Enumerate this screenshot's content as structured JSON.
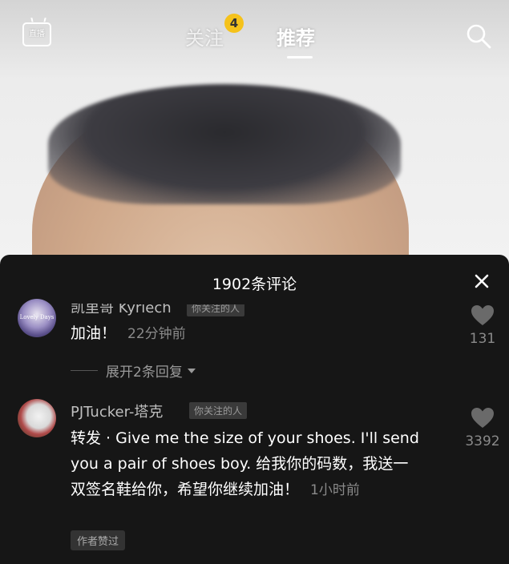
{
  "top_bar": {
    "live_label": "直播",
    "tabs": [
      {
        "label": "关注",
        "badge": "4"
      },
      {
        "label": "推荐",
        "active": true
      }
    ]
  },
  "sheet": {
    "title": "1902条评论",
    "comments": [
      {
        "user": "凯里哥 Kyriech",
        "avatar_text": "Lovely Days",
        "tag": "你关注的人",
        "text": "加油！",
        "time": "22分钟前",
        "likes": "131",
        "expand_label": "展开2条回复"
      },
      {
        "user": "PJTucker-塔克",
        "tag": "你关注的人",
        "text": "转发 · Give me the size of your shoes. I'll send you a pair of shoes boy. 给我你的码数，我送一双签名鞋给你，希望你继续加油！",
        "time": "1小时前",
        "likes": "3392",
        "author_liked": "作者赞过"
      }
    ]
  },
  "colors": {
    "badge": "#f5c21b",
    "sheet_bg": "#161616",
    "text_primary": "#ffffff",
    "text_secondary": "#8a8a8a"
  }
}
